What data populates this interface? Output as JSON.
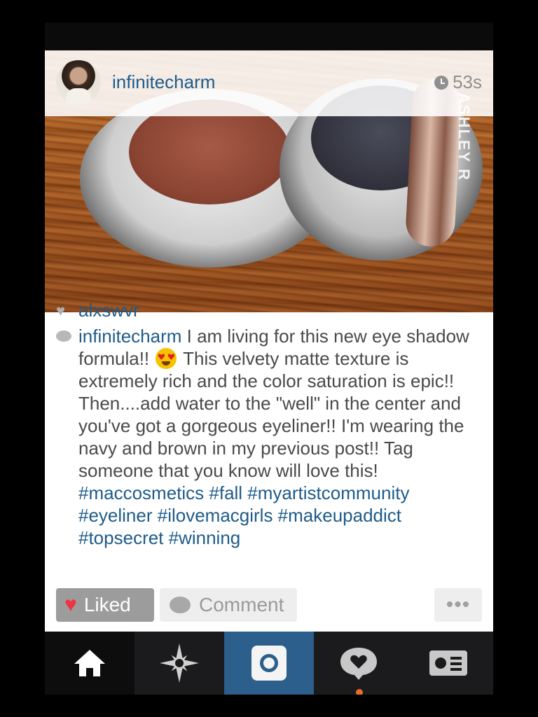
{
  "post": {
    "username": "infinitecharm",
    "time": "53s",
    "watermark": "ASHLEY R",
    "likes": {
      "user": "alxswvr"
    },
    "caption": {
      "user": "infinitecharm",
      "text_before_emoji": " I am living for this new eye shadow formula!! ",
      "text_after_emoji": " This velvety matte texture is extremely rich and the color saturation is epic!! Then....add water to the \"well\" in the center and you've got a gorgeous eyeliner!! I'm wearing the navy and brown in my previous post!! Tag someone that you know will love this! ",
      "hashtags": "#maccosmetics #fall #myartistcommunity #eyeliner #ilovemacgirls #makeupaddict #topsecret #winning"
    }
  },
  "actions": {
    "liked_label": "Liked",
    "comment_label": "Comment",
    "more_label": "•••"
  },
  "tabbar": {
    "items": [
      "home-icon",
      "explore-icon",
      "camera-icon",
      "activity-icon",
      "profile-icon"
    ]
  },
  "colors": {
    "accent": "#1e5b8a",
    "camera_tab": "#2d5f8c",
    "like": "#ee3344",
    "notification": "#ee6a2a"
  }
}
